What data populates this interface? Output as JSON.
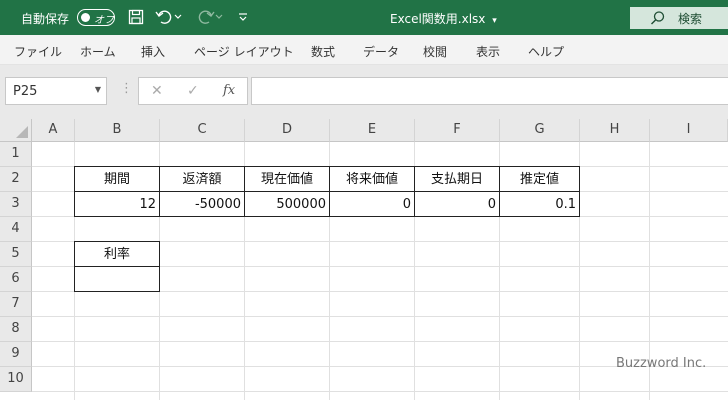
{
  "titlebar": {
    "autosave_label": "自動保存",
    "autosave_state": "オフ",
    "filename": "Excel関数用.xlsx",
    "filename_caret": "▾",
    "search_label": "検索",
    "bg_color": "#217346"
  },
  "menu": [
    "ファイル",
    "ホーム",
    "挿入",
    "ページ レイアウト",
    "数式",
    "データ",
    "校閲",
    "表示",
    "ヘルプ"
  ],
  "formulabar": {
    "name_box": "P25",
    "fx": "fx",
    "cancel": "✕",
    "enter": "✓",
    "formula": ""
  },
  "columns": [
    "A",
    "B",
    "C",
    "D",
    "E",
    "F",
    "G",
    "H",
    "I"
  ],
  "rows": [
    "1",
    "2",
    "3",
    "4",
    "5",
    "6",
    "7",
    "8",
    "9",
    "10"
  ],
  "table": {
    "headers": [
      "期間",
      "返済額",
      "現在価値",
      "将来価値",
      "支払期日",
      "推定値"
    ],
    "values": [
      "12",
      "-50000",
      "500000",
      "0",
      "0",
      "0.1"
    ]
  },
  "rate": {
    "label": "利率",
    "value": ""
  },
  "watermark": "Buzzword Inc."
}
